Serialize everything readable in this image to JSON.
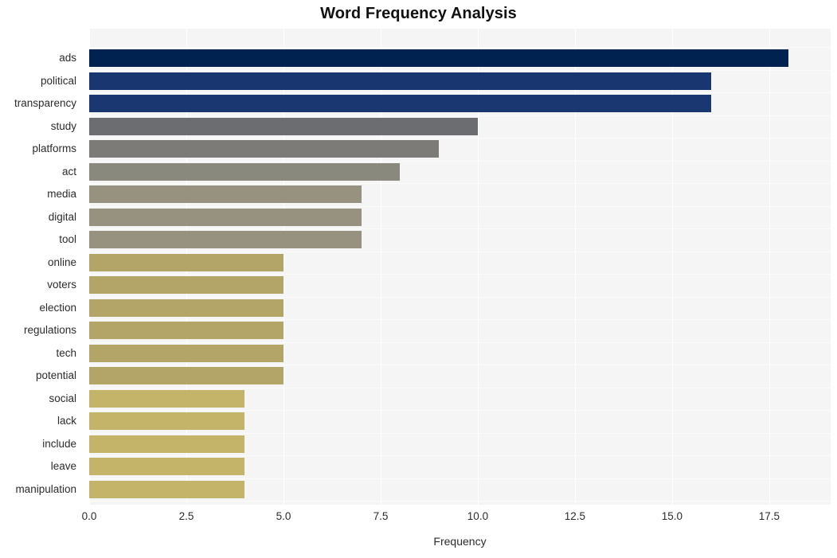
{
  "chart_data": {
    "type": "bar",
    "orientation": "horizontal",
    "title": "Word Frequency Analysis",
    "xlabel": "Frequency",
    "ylabel": "",
    "categories": [
      "ads",
      "political",
      "transparency",
      "study",
      "platforms",
      "act",
      "media",
      "digital",
      "tool",
      "online",
      "voters",
      "election",
      "regulations",
      "tech",
      "potential",
      "social",
      "lack",
      "include",
      "leave",
      "manipulation"
    ],
    "values": [
      18,
      16,
      16,
      10,
      9,
      8,
      7,
      7,
      7,
      5,
      5,
      5,
      5,
      5,
      5,
      4,
      4,
      4,
      4,
      4
    ],
    "bar_colors": [
      "#002250",
      "#1a3670",
      "#1b3771",
      "#6b6d70",
      "#7c7b78",
      "#8a897d",
      "#979280",
      "#979280",
      "#979280",
      "#b3a568",
      "#b3a568",
      "#b3a568",
      "#b3a568",
      "#b3a568",
      "#b3a568",
      "#c3b46a",
      "#c3b46a",
      "#c3b46a",
      "#c3b46a",
      "#c3b46a"
    ],
    "xticks": [
      "0.0",
      "2.5",
      "5.0",
      "7.5",
      "10.0",
      "12.5",
      "15.0",
      "17.5"
    ],
    "xtick_values": [
      0,
      2.5,
      5,
      7.5,
      10,
      12.5,
      15,
      17.5
    ],
    "xlim": [
      0,
      19.08
    ],
    "grid": true,
    "legend": "none",
    "plot_background": "#f5f5f5",
    "gridline_color": "#ffffff",
    "figure_background": "#ffffff",
    "title_color": "#111111",
    "tick_label_color": "#2b2b2b"
  }
}
